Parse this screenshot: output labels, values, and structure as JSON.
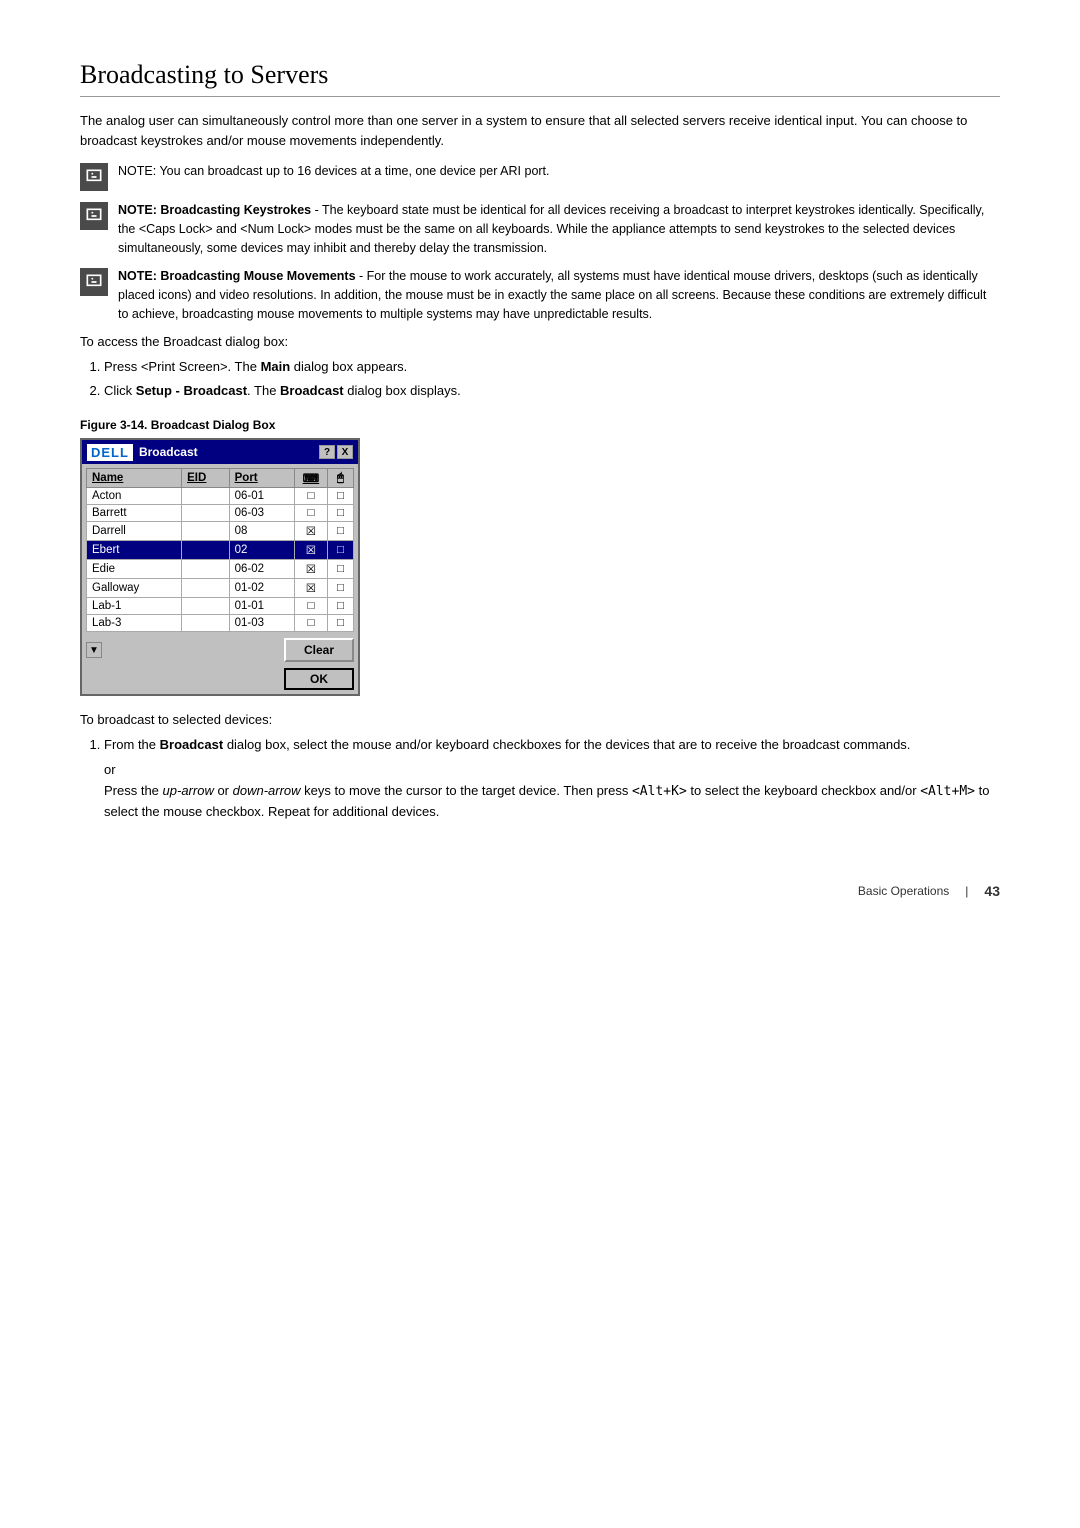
{
  "page": {
    "title": "Broadcasting to Servers",
    "intro": "The analog user can simultaneously control more than one server in a system to ensure that all selected servers receive identical input. You can choose to broadcast keystrokes and/or mouse movements independently.",
    "notes": [
      {
        "id": "note1",
        "text": "NOTE: You can broadcast up to 16 devices at a time, one device per ARI port."
      },
      {
        "id": "note2",
        "bold": "NOTE: Broadcasting Keystrokes",
        "text": " - The keyboard state must be identical for all devices receiving a broadcast to interpret keystrokes identically. Specifically, the <Caps Lock> and <Num Lock> modes must be the same on all keyboards. While the appliance attempts to send keystrokes to the selected devices simultaneously, some devices may inhibit and thereby delay the transmission."
      },
      {
        "id": "note3",
        "bold": "NOTE:  Broadcasting Mouse Movements",
        "text": " - For the mouse to work accurately, all systems must have identical mouse drivers, desktops (such as identically placed icons) and video resolutions. In addition, the mouse must be in exactly the same place on all screens. Because these conditions are extremely difficult to achieve, broadcasting mouse movements to multiple systems may have unpredictable results."
      }
    ],
    "steps_intro": "To access the Broadcast dialog box:",
    "steps": [
      {
        "num": 1,
        "text": "Press <Print Screen>. The Main dialog box appears."
      },
      {
        "num": 2,
        "text": "Click Setup - Broadcast. The Broadcast dialog box displays."
      }
    ],
    "figure_caption": "Figure 3-14.    Broadcast Dialog Box",
    "dialog": {
      "logo": "DELL",
      "title": "Broadcast",
      "help_btn": "?",
      "close_btn": "X",
      "table_headers": [
        "Name",
        "EID",
        "Port",
        "",
        ""
      ],
      "rows": [
        {
          "name": "Acton",
          "eid": "",
          "port": "06-01",
          "kb": false,
          "mouse": false,
          "selected": false
        },
        {
          "name": "Barrett",
          "eid": "",
          "port": "06-03",
          "kb": false,
          "mouse": false,
          "selected": false
        },
        {
          "name": "Darrell",
          "eid": "",
          "port": "08",
          "kb": true,
          "mouse": false,
          "selected": false
        },
        {
          "name": "Ebert",
          "eid": "",
          "port": "02",
          "kb": true,
          "mouse": false,
          "selected": true
        },
        {
          "name": "Edie",
          "eid": "",
          "port": "06-02",
          "kb": true,
          "mouse": false,
          "selected": false
        },
        {
          "name": "Galloway",
          "eid": "",
          "port": "01-02",
          "kb": true,
          "mouse": false,
          "selected": false
        },
        {
          "name": "Lab-1",
          "eid": "",
          "port": "01-01",
          "kb": false,
          "mouse": false,
          "selected": false
        },
        {
          "name": "Lab-3",
          "eid": "",
          "port": "01-03",
          "kb": false,
          "mouse": false,
          "selected": false
        }
      ],
      "clear_btn": "Clear",
      "ok_btn": "OK"
    },
    "bottom_intro": "To broadcast to selected devices:",
    "bottom_steps": [
      {
        "num": 1,
        "main": "From the Broadcast dialog box, select the mouse and/or keyboard checkboxes for the devices that are to receive the broadcast commands.",
        "sub": "or\nPress the up-arrow or down-arrow keys to move the cursor to the target device. Then press <Alt+K> to select the keyboard checkbox and/or <Alt+M> to select the mouse checkbox. Repeat for additional devices."
      }
    ],
    "footer": {
      "section": "Basic Operations",
      "separator": "|",
      "page_number": "43"
    }
  }
}
